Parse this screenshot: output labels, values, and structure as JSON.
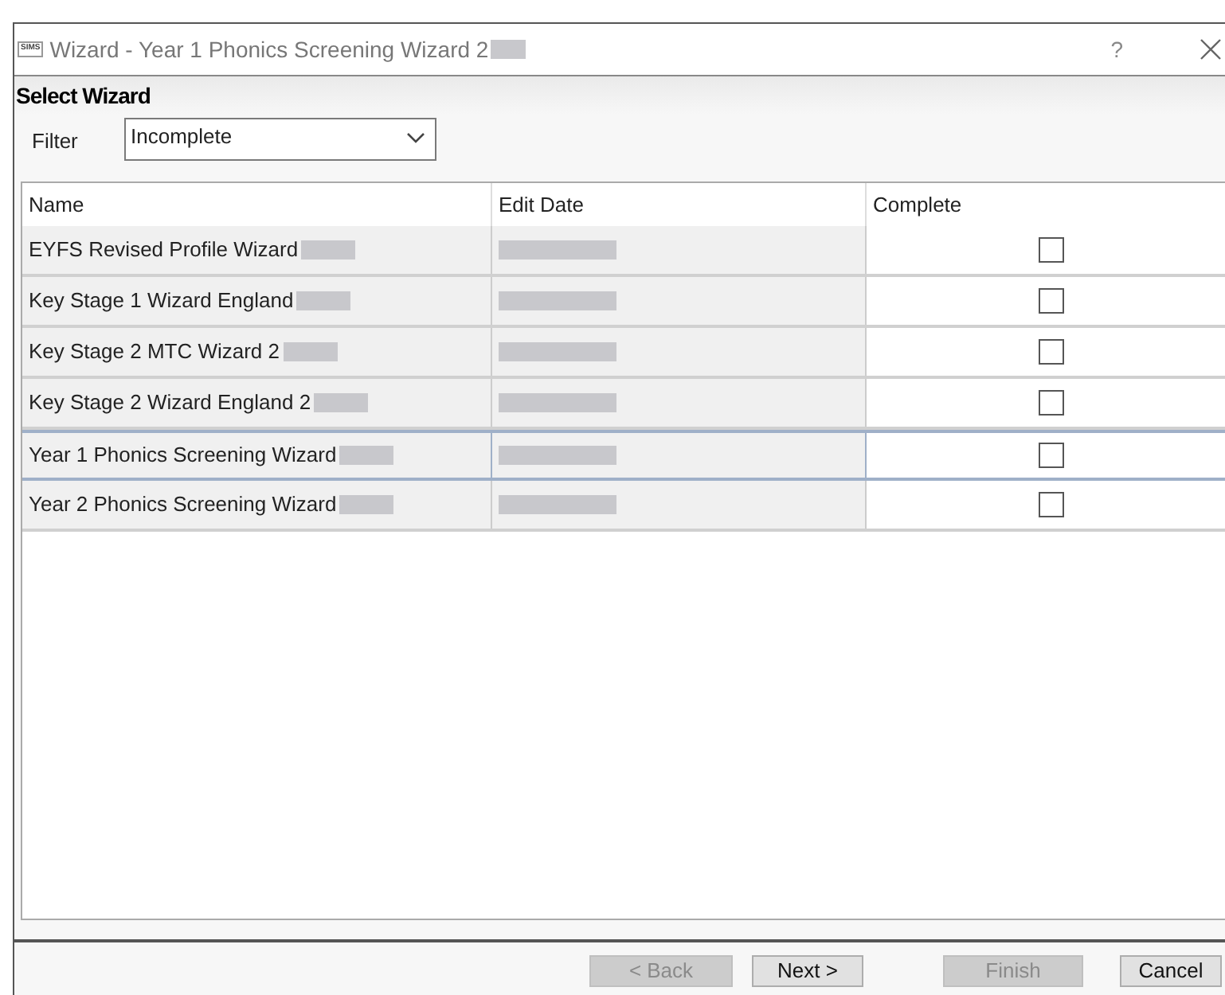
{
  "window": {
    "title": "Wizard - Year 1 Phonics Screening Wizard 2",
    "title_redacted": true,
    "app_icon_text": "SIMS",
    "help": "?"
  },
  "section": {
    "title": "Select Wizard"
  },
  "filter": {
    "label": "Filter",
    "value": "Incomplete"
  },
  "table": {
    "columns": [
      "Name",
      "Edit Date",
      "Complete"
    ],
    "rows": [
      {
        "name": "EYFS Revised Profile Wizard",
        "name_redacted": true,
        "date_redacted": true,
        "checked": false,
        "selected": false
      },
      {
        "name": "Key Stage 1 Wizard England",
        "name_redacted": true,
        "date_redacted": true,
        "checked": false,
        "selected": false
      },
      {
        "name": "Key Stage 2 MTC Wizard 2",
        "name_redacted": true,
        "date_redacted": true,
        "checked": false,
        "selected": false
      },
      {
        "name": "Key Stage 2 Wizard England 2",
        "name_redacted": true,
        "date_redacted": true,
        "checked": false,
        "selected": false
      },
      {
        "name": "Year 1 Phonics Screening Wizard",
        "name_redacted": true,
        "date_redacted": true,
        "checked": false,
        "selected": true
      },
      {
        "name": "Year 2 Phonics Screening Wizard",
        "name_redacted": true,
        "date_redacted": true,
        "checked": false,
        "selected": false
      }
    ]
  },
  "buttons": [
    {
      "label": "< Back",
      "disabled": true
    },
    {
      "label": "Next >",
      "disabled": false
    },
    {
      "label": "Finish",
      "disabled": true
    },
    {
      "label": "Cancel",
      "disabled": false
    }
  ]
}
